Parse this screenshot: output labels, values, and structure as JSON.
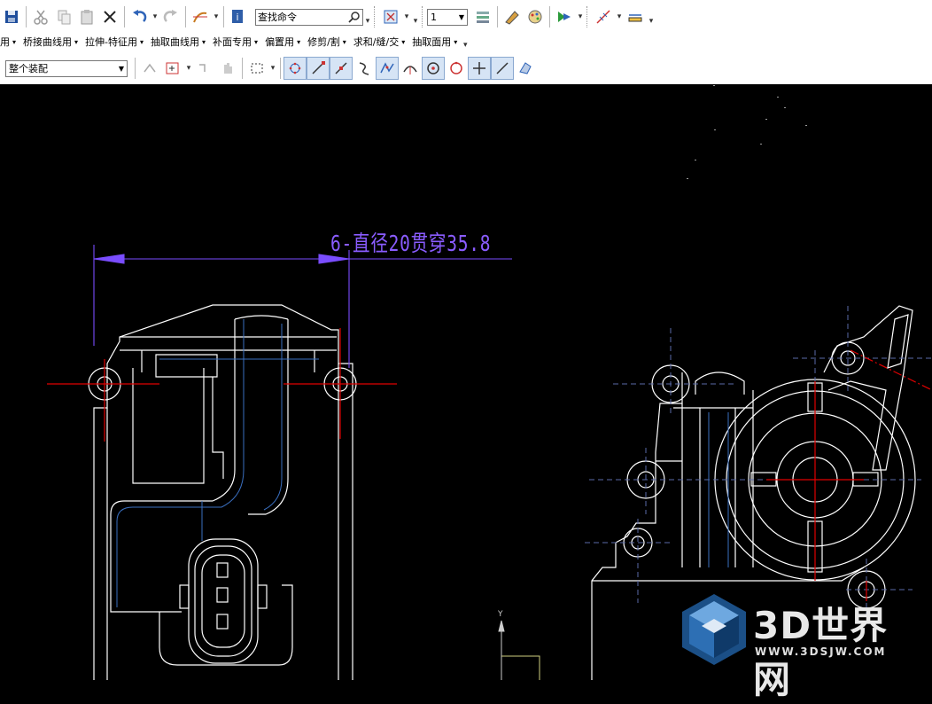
{
  "toolbar": {
    "search_placeholder": "查找命令",
    "layer_value": "1",
    "selection_filter": "整个装配",
    "menus": [
      {
        "label": "用"
      },
      {
        "label": "桥接曲线用"
      },
      {
        "label": "拉伸-特征用"
      },
      {
        "label": "抽取曲线用"
      },
      {
        "label": "补面专用"
      },
      {
        "label": "偏置用"
      },
      {
        "label": "修剪/割"
      },
      {
        "label": "求和/缝/交"
      },
      {
        "label": "抽取面用"
      }
    ]
  },
  "drawing": {
    "dimension_label": "6-直径20贯穿35.8"
  },
  "watermark": {
    "title": "3D世界网",
    "url": "WWW.3DSJW.COM"
  },
  "colors": {
    "geometry": "#ffffff",
    "centerline": "#e00000",
    "dimension": "#7a4dff",
    "hidden": "#5a6aa8",
    "accent_blue": "#3a6fc0"
  }
}
